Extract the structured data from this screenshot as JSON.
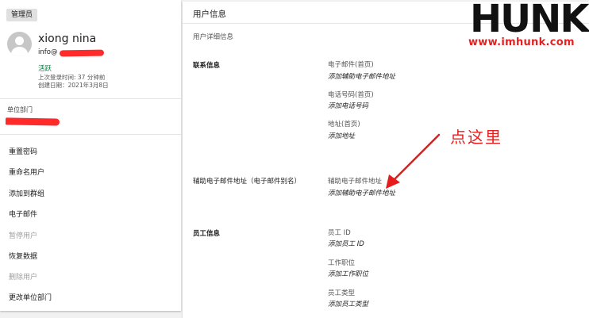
{
  "left": {
    "role_badge": "管理员",
    "user_name": "xiong nina",
    "user_email": "info@",
    "status": "活跃",
    "last_login": "上次登录时间: 37 分钟前",
    "created": "创建日期：2021年3月8日",
    "ou_label": "单位部门",
    "menu": [
      {
        "label": "重置密码",
        "enabled": true
      },
      {
        "label": "重命名用户",
        "enabled": true
      },
      {
        "label": "添加到群组",
        "enabled": true
      },
      {
        "label": "电子邮件",
        "enabled": true
      },
      {
        "label": "暂停用户",
        "enabled": false
      },
      {
        "label": "恢复数据",
        "enabled": true
      },
      {
        "label": "删除用户",
        "enabled": false
      },
      {
        "label": "更改单位部门",
        "enabled": true
      }
    ]
  },
  "right": {
    "title": "用户信息",
    "subtitle": "用户详细信息",
    "sections": {
      "contact": {
        "label": "联系信息",
        "fields": [
          {
            "label": "电子邮件(首页)",
            "value": "添加辅助电子邮件地址"
          },
          {
            "label": "电话号码(首页)",
            "value": "添加电话号码"
          },
          {
            "label": "地址(首页)",
            "value": "添加地址"
          }
        ]
      },
      "alias": {
        "label": "辅助电子邮件地址（电子邮件别名）",
        "fields": [
          {
            "label": "辅助电子邮件地址",
            "value": "添加辅助电子邮件地址"
          }
        ]
      },
      "employee": {
        "label": "员工信息",
        "fields": [
          {
            "label": "员工 ID",
            "value": "添加员工 ID"
          },
          {
            "label": "工作职位",
            "value": "添加工作职位"
          },
          {
            "label": "员工类型",
            "value": "添加员工类型"
          }
        ]
      }
    }
  },
  "watermark": {
    "logo": "HUNK",
    "url": "www.imhunk.com"
  },
  "annotation": {
    "text": "点这里",
    "color": "#e41c1c"
  },
  "colors": {
    "active_green": "#0b8043",
    "redaction_red": "#ff2a2a",
    "brand_red": "#e52020"
  }
}
